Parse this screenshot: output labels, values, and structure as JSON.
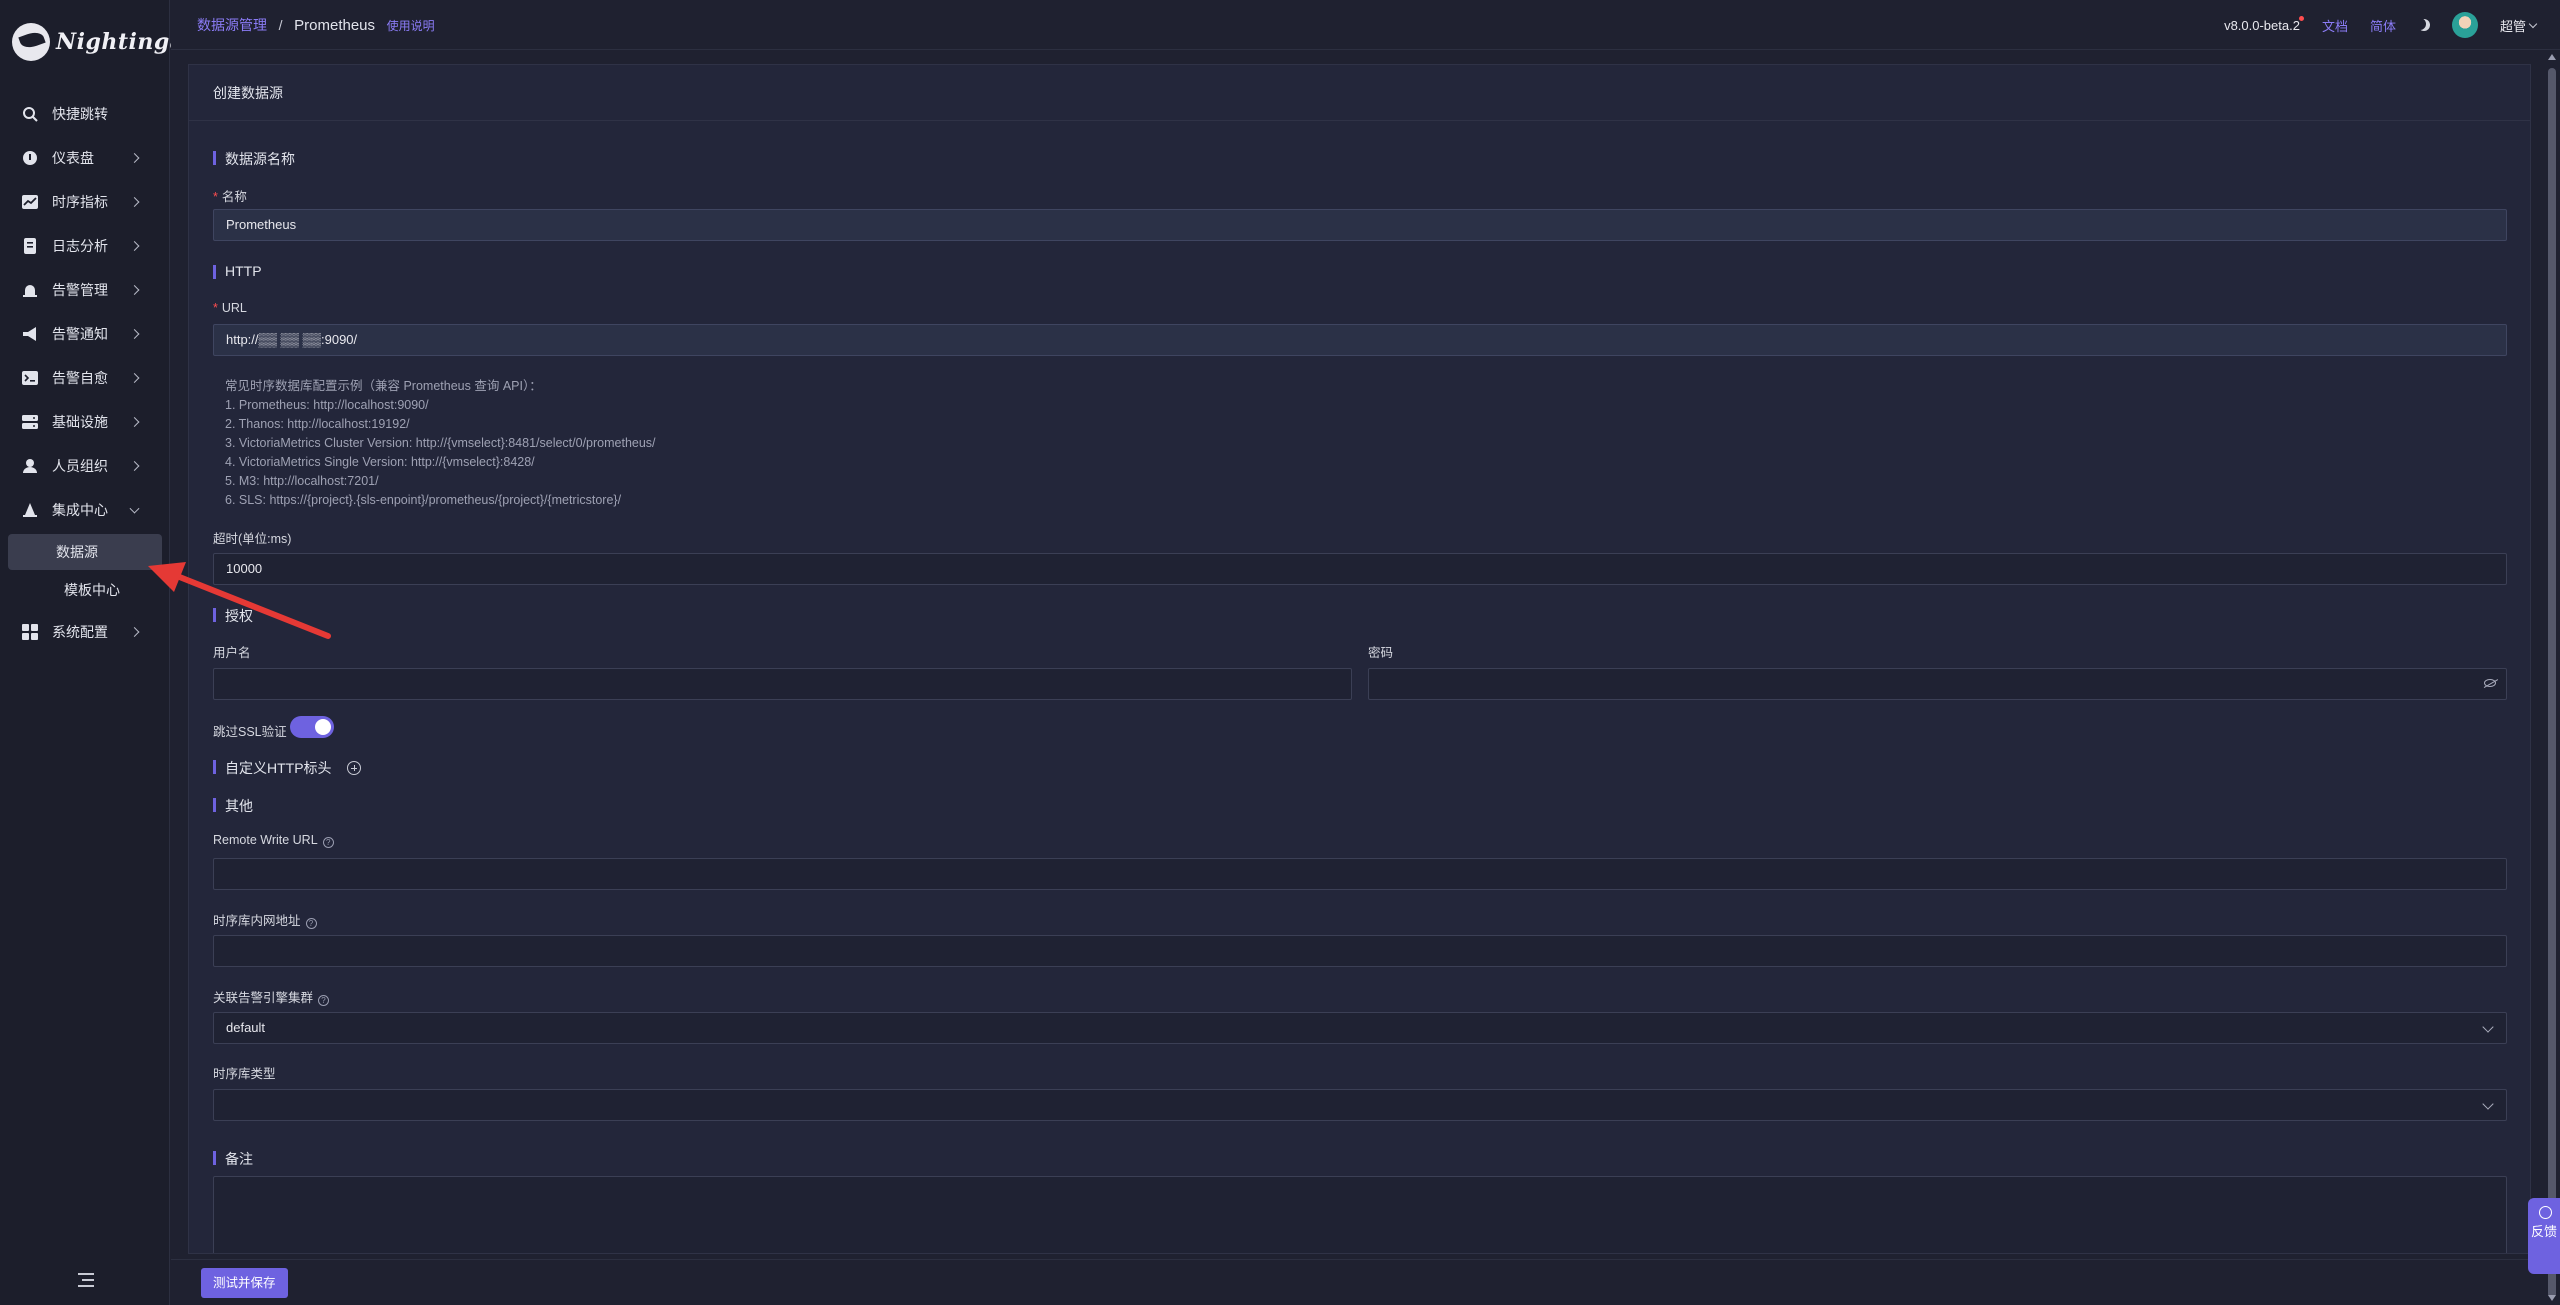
{
  "app": {
    "name": "Nightingale"
  },
  "sidebar": {
    "items": [
      {
        "label": "快捷跳转",
        "icon": "search-icon",
        "has_children": false
      },
      {
        "label": "仪表盘",
        "icon": "dashboard-icon",
        "has_children": true
      },
      {
        "label": "时序指标",
        "icon": "line-chart-icon",
        "has_children": true
      },
      {
        "label": "日志分析",
        "icon": "log-icon",
        "has_children": true
      },
      {
        "label": "告警管理",
        "icon": "alarm-bell-icon",
        "has_children": true
      },
      {
        "label": "告警通知",
        "icon": "megaphone-icon",
        "has_children": true
      },
      {
        "label": "告警自愈",
        "icon": "terminal-icon",
        "has_children": true
      },
      {
        "label": "基础设施",
        "icon": "server-icon",
        "has_children": true
      },
      {
        "label": "人员组织",
        "icon": "user-icon",
        "has_children": true
      },
      {
        "label": "集成中心",
        "icon": "integration-icon",
        "has_children": true,
        "expanded": true,
        "children": [
          {
            "label": "数据源",
            "active": true
          },
          {
            "label": "模板中心",
            "active": false
          }
        ]
      },
      {
        "label": "系统配置",
        "icon": "grid-icon",
        "has_children": true
      }
    ]
  },
  "header": {
    "breadcrumb_parent": "数据源管理",
    "breadcrumb_separator": "/",
    "breadcrumb_current": "Prometheus",
    "help_link": "使用说明",
    "version": "v8.0.0-beta.2",
    "docs_link": "文档",
    "language": "简体",
    "user": "超管"
  },
  "form": {
    "card_title": "创建数据源",
    "section_name": "数据源名称",
    "name_label": "名称",
    "name_value": "Prometheus",
    "section_http": "HTTP",
    "url_label": "URL",
    "url_value": "http://▒▒ ▒▒ ▒▒:9090/",
    "examples_title": "常见时序数据库配置示例（兼容 Prometheus 查询 API）：",
    "examples": [
      "1. Prometheus: http://localhost:9090/",
      "2. Thanos: http://localhost:19192/",
      "3. VictoriaMetrics Cluster Version: http://{vmselect}:8481/select/0/prometheus/",
      "4. VictoriaMetrics Single Version: http://{vmselect}:8428/",
      "5. M3: http://localhost:7201/",
      "6. SLS: https://{project}.{sls-enpoint}/prometheus/{project}/{metricstore}/"
    ],
    "timeout_label": "超时(单位:ms)",
    "timeout_value": "10000",
    "section_auth": "授权",
    "username_label": "用户名",
    "username_value": "",
    "password_label": "密码",
    "password_value": "",
    "skip_ssl_label": "跳过SSL验证",
    "skip_ssl_enabled": true,
    "section_headers": "自定义HTTP标头",
    "section_other": "其他",
    "remote_write_label": "Remote Write URL",
    "remote_write_value": "",
    "internal_addr_label": "时序库内网地址",
    "internal_addr_value": "",
    "engine_cluster_label": "关联告警引擎集群",
    "engine_cluster_value": "default",
    "tsdb_type_label": "时序库类型",
    "tsdb_type_value": "",
    "section_notes": "备注",
    "notes_value": "",
    "submit_label": "测试并保存"
  },
  "feedback_label": "反馈",
  "colors": {
    "accent": "#6e62e0",
    "link": "#8b7cf6",
    "background": "#1f2130",
    "annotation_arrow": "#e53935"
  }
}
